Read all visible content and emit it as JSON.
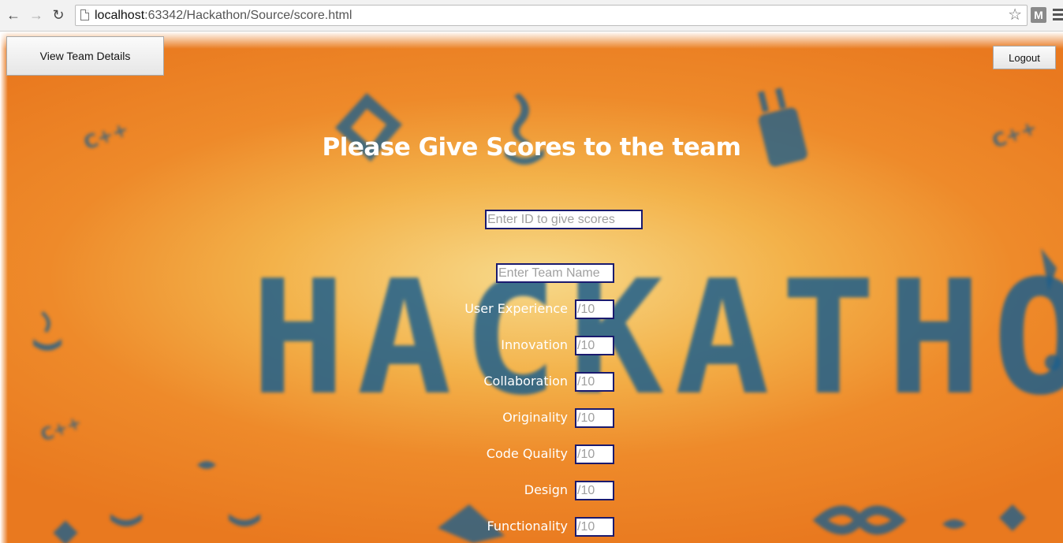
{
  "browser": {
    "url_host": "localhost",
    "url_path": ":63342/Hackathon/Source/score.html",
    "extension_label": "M"
  },
  "header": {
    "team_details_label": "View Team Details",
    "logout_label": "Logout"
  },
  "main": {
    "title": "Please Give Scores to the team",
    "id_placeholder": "Enter ID to give scores",
    "team_name_placeholder": "Enter Team Name",
    "score_placeholder": "/10",
    "criteria": [
      {
        "label": "User Experience"
      },
      {
        "label": "Innovation"
      },
      {
        "label": "Collaboration"
      },
      {
        "label": "Originality"
      },
      {
        "label": "Code Quality"
      },
      {
        "label": "Design"
      },
      {
        "label": "Functionality"
      }
    ]
  },
  "background": {
    "word": "HACKATHO",
    "icon_color": "#1d5f8c",
    "accent_orange": "#ee8a2a"
  },
  "colors": {
    "input_border": "#1a1a6e",
    "text_on_bg": "#ffffff"
  }
}
